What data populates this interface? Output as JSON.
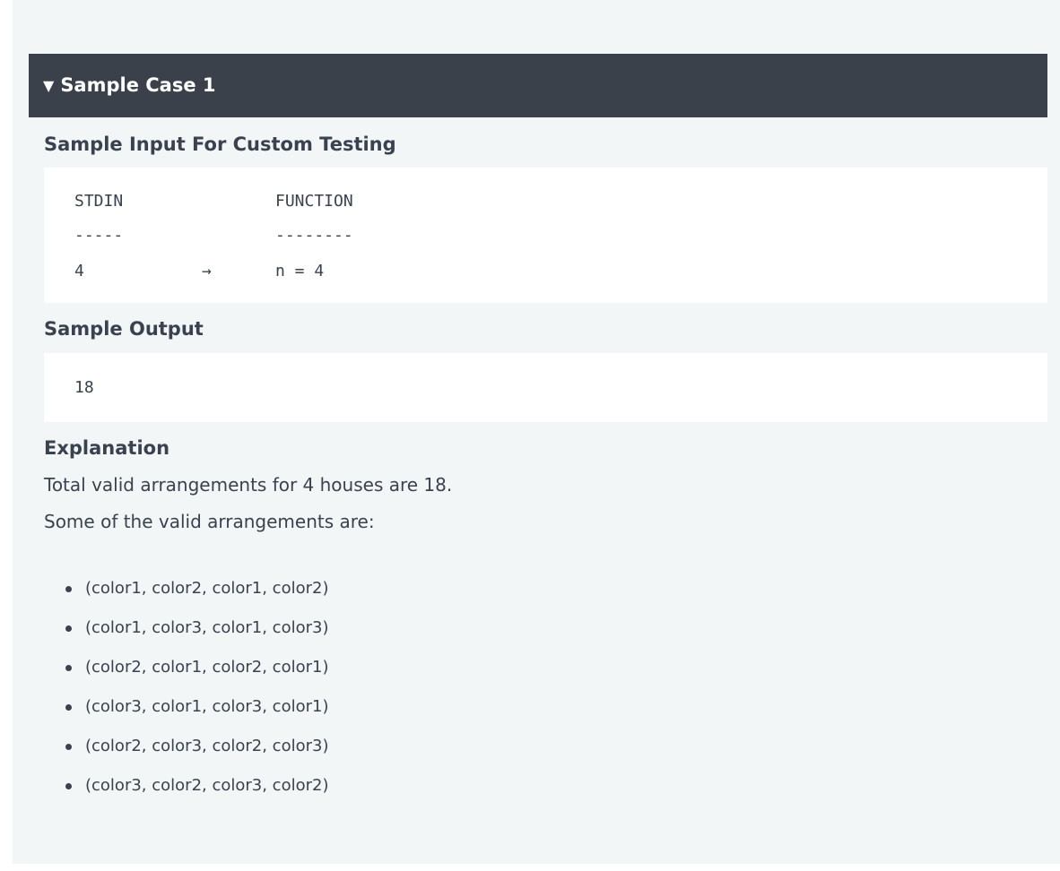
{
  "sample_case": {
    "toggle_icon": "triangle-down-icon",
    "title": "Sample Case 1"
  },
  "sample_input": {
    "heading": "Sample Input For Custom Testing",
    "col1_header": "STDIN",
    "col2_header": "FUNCTION",
    "col1_rule": "-----",
    "col2_rule": "--------",
    "row_value": "4",
    "row_arrow": "→",
    "row_function": "n = 4"
  },
  "sample_output": {
    "heading": "Sample Output",
    "value": "18"
  },
  "explanation": {
    "heading": "Explanation",
    "line1": "Total valid arrangements for 4 houses are 18.",
    "line2": "Some of the valid arrangements are:",
    "items": [
      "(color1, color2, color1, color2)",
      "(color1, color3, color1, color3)",
      "(color2, color1, color2, color1)",
      "(color3, color1, color3, color1)",
      "(color2, color3, color2, color3)",
      "(color3, color2, color3, color2)"
    ]
  },
  "colors": {
    "header_background": "#3b414b",
    "panel_background": "#f3f6f7",
    "text": "#39424e"
  }
}
